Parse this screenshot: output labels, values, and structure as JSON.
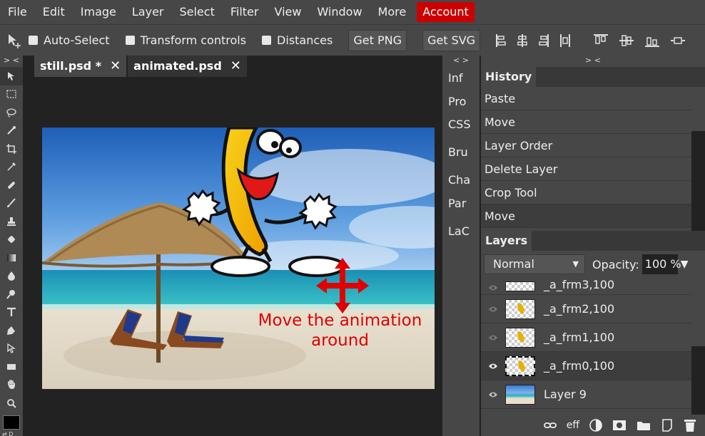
{
  "menu": {
    "items": [
      "File",
      "Edit",
      "Image",
      "Layer",
      "Select",
      "Filter",
      "View",
      "Window",
      "More"
    ],
    "account": "Account"
  },
  "options": {
    "auto_select": "Auto-Select",
    "transform_controls": "Transform controls",
    "distances": "Distances",
    "get_png": "Get PNG",
    "get_svg": "Get SVG"
  },
  "panels": {
    "collapse_left": "> <",
    "collapse_mini": "< >",
    "collapse_right": "> <"
  },
  "tabs": [
    {
      "name": "still.psd *",
      "close": "✕"
    },
    {
      "name": "animated.psd",
      "close": "✕"
    }
  ],
  "canvas": {
    "caption_line1": "Move the animation",
    "caption_line2": "around"
  },
  "mini_panels": [
    "Inf",
    "Pro",
    "CSS",
    "Bru",
    "Cha",
    "Par",
    "LaC"
  ],
  "history": {
    "title": "History",
    "items": [
      "Paste",
      "Move",
      "Layer Order",
      "Delete Layer",
      "Crop Tool",
      "Move"
    ]
  },
  "layers": {
    "title": "Layers",
    "blend_mode": "Normal",
    "opacity_label": "Opacity:",
    "opacity_value": "100 %",
    "items": [
      "_a_frm3,100",
      "_a_frm2,100",
      "_a_frm1,100",
      "_a_frm0,100",
      "Layer 9"
    ],
    "eff_label": "eff"
  },
  "colors": {
    "accent": "#cc0000",
    "panel": "#474747",
    "dark": "#222222",
    "caption": "#e00000"
  }
}
